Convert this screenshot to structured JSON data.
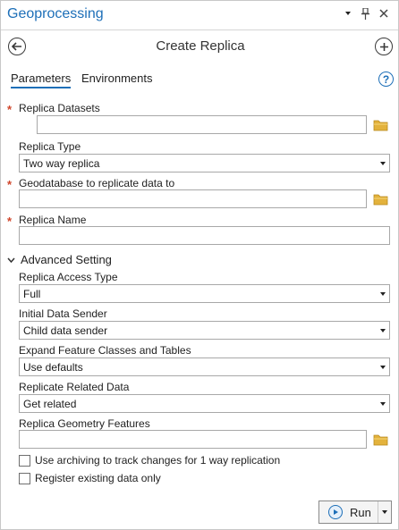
{
  "pane": {
    "title": "Geoprocessing",
    "menu_icon": "dropdown-caret-icon",
    "pin_icon": "pin-icon",
    "close_icon": "close-icon"
  },
  "header": {
    "title": "Create Replica",
    "back_icon": "back-arrow-icon",
    "add_icon": "add-icon"
  },
  "tabs": [
    {
      "label": "Parameters",
      "active": true
    },
    {
      "label": "Environments",
      "active": false
    }
  ],
  "help": {
    "glyph": "?"
  },
  "required_marker": "*",
  "fields": {
    "replica_datasets": {
      "label": "Replica Datasets",
      "value": ""
    },
    "replica_type": {
      "label": "Replica Type",
      "value": "Two way replica"
    },
    "geodatabase": {
      "label": "Geodatabase to replicate data to",
      "value": ""
    },
    "replica_name": {
      "label": "Replica Name",
      "value": ""
    }
  },
  "advanced": {
    "label": "Advanced Setting",
    "access_type": {
      "label": "Replica Access Type",
      "value": "Full"
    },
    "data_sender": {
      "label": "Initial Data Sender",
      "value": "Child data sender"
    },
    "expand_feature": {
      "label": "Expand Feature Classes and Tables",
      "value": "Use defaults"
    },
    "related_data": {
      "label": "Replicate Related Data",
      "value": "Get related"
    },
    "geometry_features": {
      "label": "Replica Geometry Features",
      "value": ""
    },
    "use_archiving": {
      "label": "Use archiving to track changes for 1 way replication",
      "checked": false
    },
    "register_existing": {
      "label": "Register existing data only",
      "checked": false
    }
  },
  "run": {
    "label": "Run"
  },
  "colors": {
    "accent": "#1d6fb8",
    "required": "#d0452a",
    "folder": "#e3b23c"
  }
}
